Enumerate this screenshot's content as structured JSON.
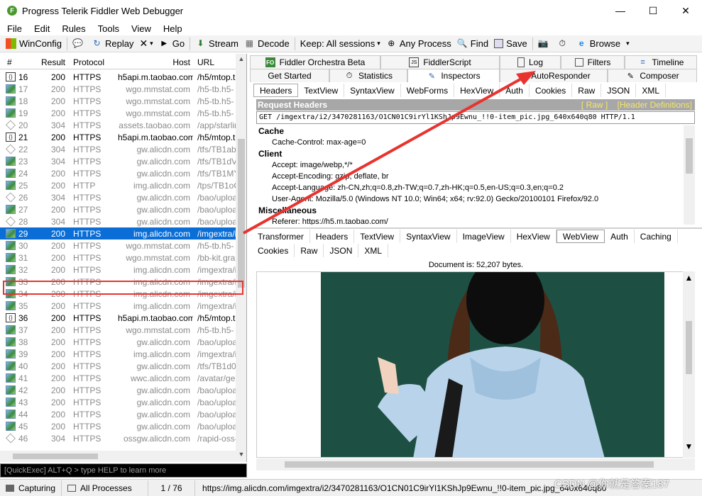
{
  "window": {
    "title": "Progress Telerik Fiddler Web Debugger",
    "min": "—",
    "max": "☐",
    "close": "✕"
  },
  "menu": [
    "File",
    "Edit",
    "Rules",
    "Tools",
    "View",
    "Help"
  ],
  "toolbar": {
    "winconfig": "WinConfig",
    "replay": "Replay",
    "remove": "✕",
    "go": "Go",
    "stream": "Stream",
    "decode": "Decode",
    "keep": "Keep: All sessions",
    "any_process": "Any Process",
    "find": "Find",
    "save": "Save",
    "browse": "Browse"
  },
  "sessions": {
    "columns": [
      "#",
      "Result",
      "Protocol",
      "Host",
      "URL"
    ],
    "rows": [
      {
        "num": "16",
        "result": "200",
        "protocol": "HTTPS",
        "host": "h5api.m.taobao.com",
        "url": "/h5/mtop.t",
        "icon": "js",
        "style": "black"
      },
      {
        "num": "17",
        "result": "200",
        "protocol": "HTTPS",
        "host": "wgo.mmstat.com",
        "url": "/h5-tb.h5-",
        "icon": "img",
        "style": "gray"
      },
      {
        "num": "18",
        "result": "200",
        "protocol": "HTTPS",
        "host": "wgo.mmstat.com",
        "url": "/h5-tb.h5-",
        "icon": "img",
        "style": "gray"
      },
      {
        "num": "19",
        "result": "200",
        "protocol": "HTTPS",
        "host": "wgo.mmstat.com",
        "url": "/h5-tb.h5-",
        "icon": "img",
        "style": "gray"
      },
      {
        "num": "20",
        "result": "304",
        "protocol": "HTTPS",
        "host": "assets.taobao.com",
        "url": "/app/starlin",
        "icon": "dia",
        "style": "gray"
      },
      {
        "num": "21",
        "result": "200",
        "protocol": "HTTPS",
        "host": "h5api.m.taobao.com",
        "url": "/h5/mtop.t",
        "icon": "js",
        "style": "black"
      },
      {
        "num": "22",
        "result": "304",
        "protocol": "HTTPS",
        "host": "gw.alicdn.com",
        "url": "/tfs/TB1ab",
        "icon": "dia",
        "style": "gray"
      },
      {
        "num": "23",
        "result": "304",
        "protocol": "HTTPS",
        "host": "gw.alicdn.com",
        "url": "/tfs/TB1dV",
        "icon": "img",
        "style": "gray"
      },
      {
        "num": "24",
        "result": "200",
        "protocol": "HTTPS",
        "host": "gw.alicdn.com",
        "url": "/tfs/TB1MY",
        "icon": "img",
        "style": "gray"
      },
      {
        "num": "25",
        "result": "200",
        "protocol": "HTTP",
        "host": "img.alicdn.com",
        "url": "/tps/TB1oC",
        "icon": "img",
        "style": "gray"
      },
      {
        "num": "26",
        "result": "304",
        "protocol": "HTTPS",
        "host": "gw.alicdn.com",
        "url": "/bao/uploa",
        "icon": "dia",
        "style": "gray"
      },
      {
        "num": "27",
        "result": "200",
        "protocol": "HTTPS",
        "host": "gw.alicdn.com",
        "url": "/bao/uploa",
        "icon": "img",
        "style": "gray"
      },
      {
        "num": "28",
        "result": "304",
        "protocol": "HTTPS",
        "host": "gw.alicdn.com",
        "url": "/bao/uploa",
        "icon": "dia",
        "style": "gray"
      },
      {
        "num": "29",
        "result": "200",
        "protocol": "HTTPS",
        "host": "img.alicdn.com",
        "url": "/imgextra/i",
        "icon": "img",
        "style": "sel"
      },
      {
        "num": "30",
        "result": "200",
        "protocol": "HTTPS",
        "host": "wgo.mmstat.com",
        "url": "/h5-tb.h5-",
        "icon": "img",
        "style": "gray"
      },
      {
        "num": "31",
        "result": "200",
        "protocol": "HTTPS",
        "host": "wgo.mmstat.com",
        "url": "/bb-kit.gra",
        "icon": "img",
        "style": "gray"
      },
      {
        "num": "32",
        "result": "200",
        "protocol": "HTTPS",
        "host": "img.alicdn.com",
        "url": "/imgextra/i",
        "icon": "img",
        "style": "gray"
      },
      {
        "num": "33",
        "result": "200",
        "protocol": "HTTPS",
        "host": "img.alicdn.com",
        "url": "/imgextra/i",
        "icon": "img",
        "style": "gray"
      },
      {
        "num": "34",
        "result": "200",
        "protocol": "HTTPS",
        "host": "img.alicdn.com",
        "url": "/imgextra/i",
        "icon": "img",
        "style": "gray"
      },
      {
        "num": "35",
        "result": "200",
        "protocol": "HTTPS",
        "host": "img.alicdn.com",
        "url": "/imgextra/i",
        "icon": "img",
        "style": "gray"
      },
      {
        "num": "36",
        "result": "200",
        "protocol": "HTTPS",
        "host": "h5api.m.taobao.com",
        "url": "/h5/mtop.t",
        "icon": "js",
        "style": "black"
      },
      {
        "num": "37",
        "result": "200",
        "protocol": "HTTPS",
        "host": "wgo.mmstat.com",
        "url": "/h5-tb.h5-",
        "icon": "img",
        "style": "gray"
      },
      {
        "num": "38",
        "result": "200",
        "protocol": "HTTPS",
        "host": "gw.alicdn.com",
        "url": "/bao/uploa",
        "icon": "img",
        "style": "gray"
      },
      {
        "num": "39",
        "result": "200",
        "protocol": "HTTPS",
        "host": "img.alicdn.com",
        "url": "/imgextra/i",
        "icon": "img",
        "style": "gray"
      },
      {
        "num": "40",
        "result": "200",
        "protocol": "HTTPS",
        "host": "gw.alicdn.com",
        "url": "/tfs/TB1d0",
        "icon": "img",
        "style": "gray"
      },
      {
        "num": "41",
        "result": "200",
        "protocol": "HTTPS",
        "host": "wwc.alicdn.com",
        "url": "/avatar/ge",
        "icon": "img",
        "style": "gray"
      },
      {
        "num": "42",
        "result": "200",
        "protocol": "HTTPS",
        "host": "gw.alicdn.com",
        "url": "/bao/uploa",
        "icon": "img",
        "style": "gray"
      },
      {
        "num": "43",
        "result": "200",
        "protocol": "HTTPS",
        "host": "gw.alicdn.com",
        "url": "/bao/uploa",
        "icon": "img",
        "style": "gray"
      },
      {
        "num": "44",
        "result": "200",
        "protocol": "HTTPS",
        "host": "gw.alicdn.com",
        "url": "/bao/uploa",
        "icon": "img",
        "style": "gray"
      },
      {
        "num": "45",
        "result": "200",
        "protocol": "HTTPS",
        "host": "gw.alicdn.com",
        "url": "/bao/uploa",
        "icon": "img",
        "style": "gray"
      },
      {
        "num": "46",
        "result": "304",
        "protocol": "HTTPS",
        "host": "ossgw.alicdn.com",
        "url": "/rapid-oss-",
        "icon": "dia",
        "style": "gray"
      }
    ]
  },
  "quickexec": "[QuickExec] ALT+Q > type HELP to learn more",
  "status": {
    "capturing": "Capturing",
    "processes": "All Processes",
    "count": "1 / 76",
    "url": "https://img.alicdn.com/imgextra/i2/3470281163/O1CN01C9irYl1KShJp9Ewnu_!!0-item_pic.jpg_640x640q80"
  },
  "tabs_row1": [
    "Fiddler Orchestra Beta",
    "FiddlerScript",
    "Log",
    "Filters",
    "Timeline"
  ],
  "tabs_row2": [
    "Get Started",
    "Statistics",
    "Inspectors",
    "AutoResponder",
    "Composer"
  ],
  "request_tabs": [
    "Headers",
    "TextView",
    "SyntaxView",
    "WebForms",
    "HexView",
    "Auth",
    "Cookies",
    "Raw",
    "JSON",
    "XML"
  ],
  "request": {
    "title": "Request Headers",
    "raw_link": "[ Raw ]",
    "defs_link": "[Header Definitions]",
    "line": "GET /imgextra/i2/3470281163/O1CN01C9irYl1KShJp9Ewnu_!!0-item_pic.jpg_640x640q80 HTTP/1.1",
    "groups": [
      {
        "name": "Cache",
        "lines": [
          "Cache-Control: max-age=0"
        ]
      },
      {
        "name": "Client",
        "lines": [
          "Accept: image/webp,*/*",
          "Accept-Encoding: gzip, deflate, br",
          "Accept-Language: zh-CN,zh;q=0.8,zh-TW;q=0.7,zh-HK;q=0.5,en-US;q=0.3,en;q=0.2",
          "User-Agent: Mozilla/5.0 (Windows NT 10.0; Win64; x64; rv:92.0) Gecko/20100101 Firefox/92.0"
        ]
      },
      {
        "name": "Miscellaneous",
        "lines": [
          "Referer: https://h5.m.taobao.com/"
        ]
      }
    ]
  },
  "response_tabs_row1": [
    "Transformer",
    "Headers",
    "TextView",
    "SyntaxView",
    "ImageView",
    "HexView",
    "WebView",
    "Auth",
    "Caching"
  ],
  "response_tabs_row2": [
    "Cookies",
    "Raw",
    "JSON",
    "XML"
  ],
  "response": {
    "doc_info": "Document is: 52,207 bytes."
  },
  "watermark": "CSDN @你就是答案187",
  "colors": {
    "selection": "#0a6ed6",
    "annotation": "#e8332f",
    "photo_bg": "#1d5043"
  }
}
